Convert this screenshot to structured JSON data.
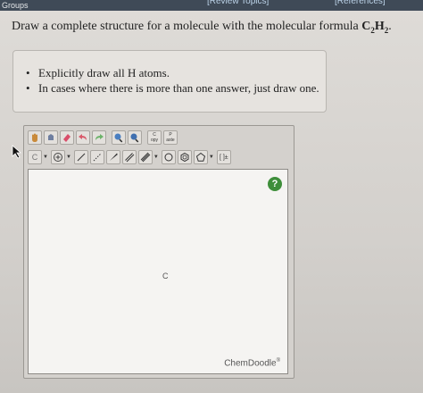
{
  "topbar": {
    "groups_label": "Groups",
    "review_topics_label": "[Review Topics]",
    "references_label": "[References]"
  },
  "question": {
    "prefix": "Draw a complete structure for a molecule with the molecular formula ",
    "formula_c": "C",
    "formula_c_sub": "2",
    "formula_h": "H",
    "formula_h_sub": "2",
    "suffix": "."
  },
  "instructions": [
    "Explicitly draw all H atoms.",
    "In cases where there is more than one answer, just draw one."
  ],
  "editor": {
    "element_select_value": "C",
    "canvas_atom": "C",
    "help_symbol": "?",
    "brand": "ChemDoodle",
    "brand_mark": "®",
    "tool_label_clean": "C\nopy",
    "tool_label_paste": "P\naste",
    "tool_label_brackets": "[ ]±"
  },
  "colors": {
    "topbar": "#3f4a57",
    "help_green": "#3e8e3a",
    "canvas_bg": "#f5f4f2"
  }
}
